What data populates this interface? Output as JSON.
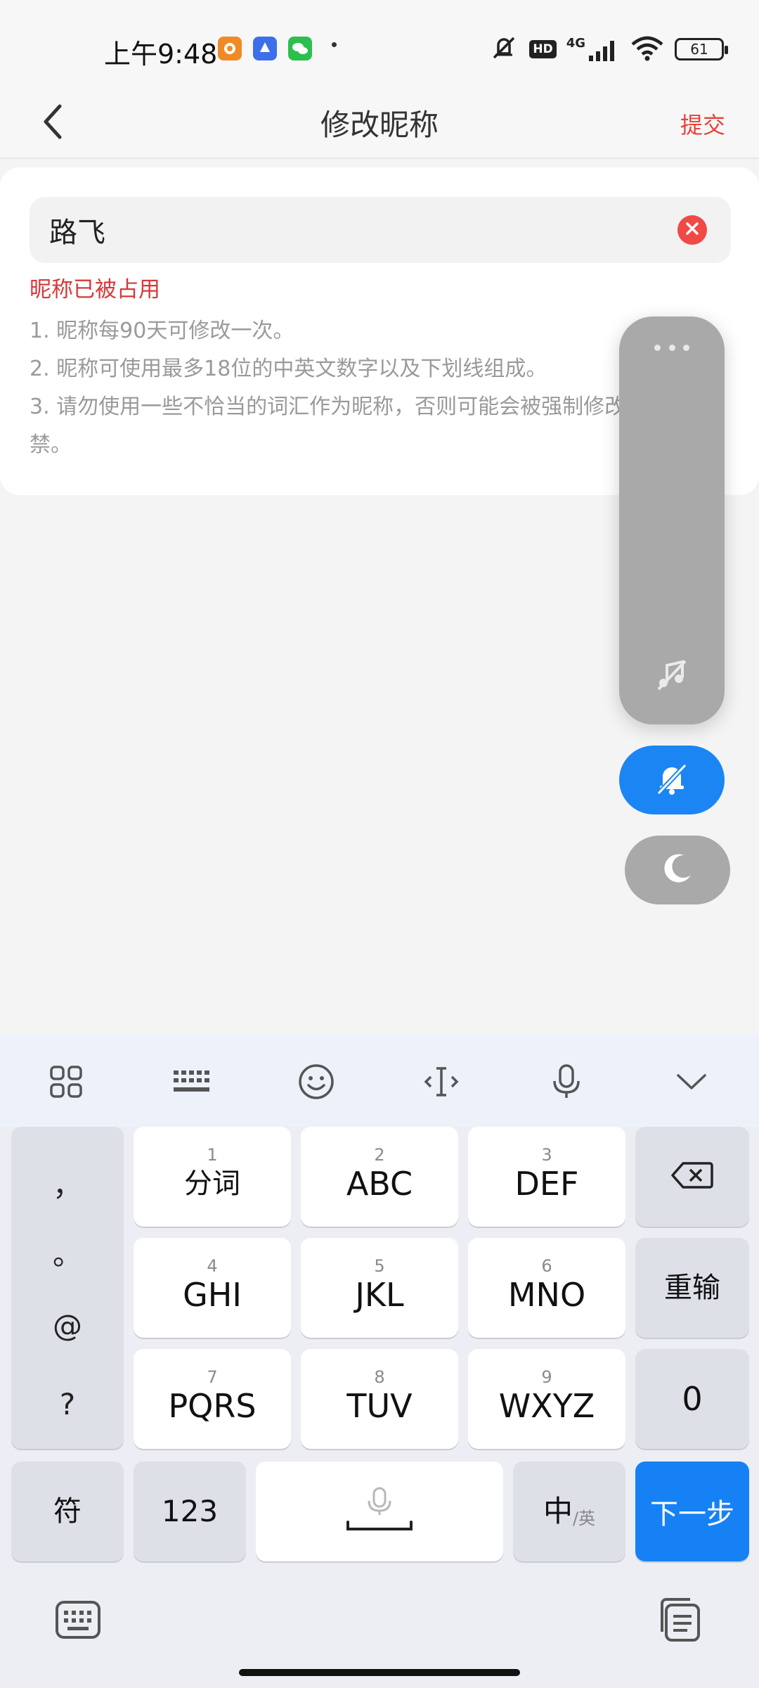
{
  "status_bar": {
    "time": "上午9:48",
    "network": "4G",
    "hd": "HD",
    "battery": "61"
  },
  "header": {
    "title": "修改昵称",
    "submit_label": "提交"
  },
  "nickname": {
    "value": "路飞",
    "error": "昵称已被占用",
    "rules": [
      "1. 昵称每90天可修改一次。",
      "2. 昵称可使用最多18位的中英文数字以及下划线组成。",
      "3. 请勿使用一些不恰当的词汇作为昵称，否则可能会被强制修改或甚至封禁。"
    ]
  },
  "float_panel": {
    "icons": [
      "more-dots-icon",
      "music-off-icon",
      "bell-off-icon",
      "moon-icon"
    ],
    "active_color": "#1b86f3"
  },
  "keyboard": {
    "side_symbols": [
      "，",
      "。",
      "@",
      "?"
    ],
    "keys": [
      {
        "num": "1",
        "label": "分词"
      },
      {
        "num": "2",
        "label": "ABC"
      },
      {
        "num": "3",
        "label": "DEF"
      },
      {
        "num": "4",
        "label": "GHI"
      },
      {
        "num": "5",
        "label": "JKL"
      },
      {
        "num": "6",
        "label": "MNO"
      },
      {
        "num": "7",
        "label": "PQRS"
      },
      {
        "num": "8",
        "label": "TUV"
      },
      {
        "num": "9",
        "label": "WXYZ"
      }
    ],
    "reset": "重输",
    "zero": "0",
    "symbols": "符",
    "numeric": "123",
    "lang_main": "中",
    "lang_sub": "/英",
    "next": "下一步",
    "accent_color": "#1681f5"
  }
}
